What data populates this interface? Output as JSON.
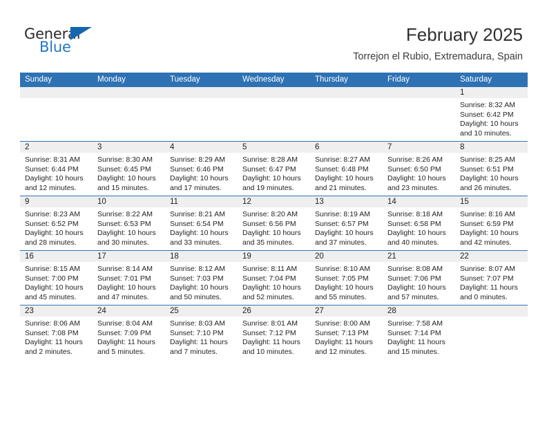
{
  "brand": {
    "name_part1": "General",
    "name_part2": "Blue",
    "triangle_icon": "triangle-icon",
    "accent_color": "#2478c8",
    "triangle_color": "#1566b0"
  },
  "header": {
    "title": "February 2025",
    "subtitle": "Torrejon el Rubio, Extremadura, Spain"
  },
  "theme": {
    "header_blue": "#2e72b4",
    "daynum_band": "#efefef",
    "text": "#232323"
  },
  "weekdays": [
    "Sunday",
    "Monday",
    "Tuesday",
    "Wednesday",
    "Thursday",
    "Friday",
    "Saturday"
  ],
  "labels": {
    "sunrise": "Sunrise:",
    "sunset": "Sunset:",
    "daylight": "Daylight:"
  },
  "weeks": [
    [
      {
        "day": "",
        "blank": true
      },
      {
        "day": "",
        "blank": true
      },
      {
        "day": "",
        "blank": true
      },
      {
        "day": "",
        "blank": true
      },
      {
        "day": "",
        "blank": true
      },
      {
        "day": "",
        "blank": true
      },
      {
        "day": "1",
        "sunrise": "Sunrise: 8:32 AM",
        "sunset": "Sunset: 6:42 PM",
        "daylight": "Daylight: 10 hours and 10 minutes."
      }
    ],
    [
      {
        "day": "2",
        "sunrise": "Sunrise: 8:31 AM",
        "sunset": "Sunset: 6:44 PM",
        "daylight": "Daylight: 10 hours and 12 minutes."
      },
      {
        "day": "3",
        "sunrise": "Sunrise: 8:30 AM",
        "sunset": "Sunset: 6:45 PM",
        "daylight": "Daylight: 10 hours and 15 minutes."
      },
      {
        "day": "4",
        "sunrise": "Sunrise: 8:29 AM",
        "sunset": "Sunset: 6:46 PM",
        "daylight": "Daylight: 10 hours and 17 minutes."
      },
      {
        "day": "5",
        "sunrise": "Sunrise: 8:28 AM",
        "sunset": "Sunset: 6:47 PM",
        "daylight": "Daylight: 10 hours and 19 minutes."
      },
      {
        "day": "6",
        "sunrise": "Sunrise: 8:27 AM",
        "sunset": "Sunset: 6:48 PM",
        "daylight": "Daylight: 10 hours and 21 minutes."
      },
      {
        "day": "7",
        "sunrise": "Sunrise: 8:26 AM",
        "sunset": "Sunset: 6:50 PM",
        "daylight": "Daylight: 10 hours and 23 minutes."
      },
      {
        "day": "8",
        "sunrise": "Sunrise: 8:25 AM",
        "sunset": "Sunset: 6:51 PM",
        "daylight": "Daylight: 10 hours and 26 minutes."
      }
    ],
    [
      {
        "day": "9",
        "sunrise": "Sunrise: 8:23 AM",
        "sunset": "Sunset: 6:52 PM",
        "daylight": "Daylight: 10 hours and 28 minutes."
      },
      {
        "day": "10",
        "sunrise": "Sunrise: 8:22 AM",
        "sunset": "Sunset: 6:53 PM",
        "daylight": "Daylight: 10 hours and 30 minutes."
      },
      {
        "day": "11",
        "sunrise": "Sunrise: 8:21 AM",
        "sunset": "Sunset: 6:54 PM",
        "daylight": "Daylight: 10 hours and 33 minutes."
      },
      {
        "day": "12",
        "sunrise": "Sunrise: 8:20 AM",
        "sunset": "Sunset: 6:56 PM",
        "daylight": "Daylight: 10 hours and 35 minutes."
      },
      {
        "day": "13",
        "sunrise": "Sunrise: 8:19 AM",
        "sunset": "Sunset: 6:57 PM",
        "daylight": "Daylight: 10 hours and 37 minutes."
      },
      {
        "day": "14",
        "sunrise": "Sunrise: 8:18 AM",
        "sunset": "Sunset: 6:58 PM",
        "daylight": "Daylight: 10 hours and 40 minutes."
      },
      {
        "day": "15",
        "sunrise": "Sunrise: 8:16 AM",
        "sunset": "Sunset: 6:59 PM",
        "daylight": "Daylight: 10 hours and 42 minutes."
      }
    ],
    [
      {
        "day": "16",
        "sunrise": "Sunrise: 8:15 AM",
        "sunset": "Sunset: 7:00 PM",
        "daylight": "Daylight: 10 hours and 45 minutes."
      },
      {
        "day": "17",
        "sunrise": "Sunrise: 8:14 AM",
        "sunset": "Sunset: 7:01 PM",
        "daylight": "Daylight: 10 hours and 47 minutes."
      },
      {
        "day": "18",
        "sunrise": "Sunrise: 8:12 AM",
        "sunset": "Sunset: 7:03 PM",
        "daylight": "Daylight: 10 hours and 50 minutes."
      },
      {
        "day": "19",
        "sunrise": "Sunrise: 8:11 AM",
        "sunset": "Sunset: 7:04 PM",
        "daylight": "Daylight: 10 hours and 52 minutes."
      },
      {
        "day": "20",
        "sunrise": "Sunrise: 8:10 AM",
        "sunset": "Sunset: 7:05 PM",
        "daylight": "Daylight: 10 hours and 55 minutes."
      },
      {
        "day": "21",
        "sunrise": "Sunrise: 8:08 AM",
        "sunset": "Sunset: 7:06 PM",
        "daylight": "Daylight: 10 hours and 57 minutes."
      },
      {
        "day": "22",
        "sunrise": "Sunrise: 8:07 AM",
        "sunset": "Sunset: 7:07 PM",
        "daylight": "Daylight: 11 hours and 0 minutes."
      }
    ],
    [
      {
        "day": "23",
        "sunrise": "Sunrise: 8:06 AM",
        "sunset": "Sunset: 7:08 PM",
        "daylight": "Daylight: 11 hours and 2 minutes."
      },
      {
        "day": "24",
        "sunrise": "Sunrise: 8:04 AM",
        "sunset": "Sunset: 7:09 PM",
        "daylight": "Daylight: 11 hours and 5 minutes."
      },
      {
        "day": "25",
        "sunrise": "Sunrise: 8:03 AM",
        "sunset": "Sunset: 7:10 PM",
        "daylight": "Daylight: 11 hours and 7 minutes."
      },
      {
        "day": "26",
        "sunrise": "Sunrise: 8:01 AM",
        "sunset": "Sunset: 7:12 PM",
        "daylight": "Daylight: 11 hours and 10 minutes."
      },
      {
        "day": "27",
        "sunrise": "Sunrise: 8:00 AM",
        "sunset": "Sunset: 7:13 PM",
        "daylight": "Daylight: 11 hours and 12 minutes."
      },
      {
        "day": "28",
        "sunrise": "Sunrise: 7:58 AM",
        "sunset": "Sunset: 7:14 PM",
        "daylight": "Daylight: 11 hours and 15 minutes."
      },
      {
        "day": "",
        "blank": true
      }
    ]
  ]
}
